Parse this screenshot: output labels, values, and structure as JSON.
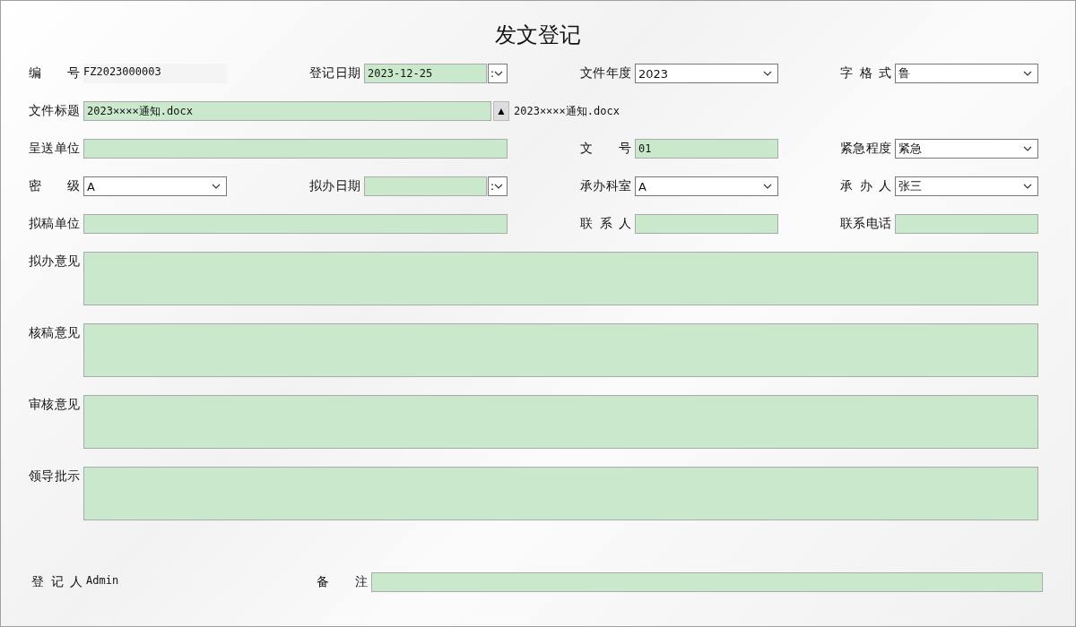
{
  "title": "发文登记",
  "rows": [
    [
      {
        "label": "编号",
        "kind": "static",
        "value": "FZ2023000003"
      },
      {
        "label": "登记日期",
        "kind": "date",
        "value": "2023-12-25",
        "button": ":"
      },
      {
        "label": "文件年度",
        "kind": "select",
        "value": "2023"
      },
      {
        "label": "字格式",
        "kind": "select",
        "value": "鲁"
      }
    ],
    [
      {
        "label": "文件标题",
        "kind": "file",
        "value": "2023××××通知.docx",
        "button": "▲",
        "note": "2023××××通知.docx"
      }
    ],
    [
      {
        "label": "呈送单位",
        "kind": "wide"
      },
      {
        "label": "文号",
        "kind": "input",
        "value": "01"
      },
      {
        "label": "紧急程度",
        "kind": "select",
        "value": "紧急"
      }
    ],
    [
      {
        "label": "密级",
        "kind": "select",
        "value": "A"
      },
      {
        "label": "拟办日期",
        "kind": "date",
        "button": ":"
      },
      {
        "label": "承办科室",
        "kind": "select",
        "value": "A"
      },
      {
        "label": "承办人",
        "kind": "select",
        "value": "张三"
      }
    ],
    [
      {
        "label": "拟稿单位",
        "kind": "wide"
      },
      {
        "label": "联系人",
        "kind": "input"
      },
      {
        "label": "联系电话",
        "kind": "input"
      }
    ],
    [
      {
        "label": "拟办意见",
        "kind": "memo"
      }
    ],
    [
      {
        "label": "核稿意见",
        "kind": "memo"
      }
    ],
    [
      {
        "label": "审核意见",
        "kind": "memo"
      }
    ],
    [
      {
        "label": "领导批示",
        "kind": "memo"
      }
    ]
  ],
  "footer": [
    {
      "label": "登记人",
      "kind": "static",
      "value": "Admin"
    },
    {
      "label": "备注",
      "kind": "input"
    }
  ]
}
